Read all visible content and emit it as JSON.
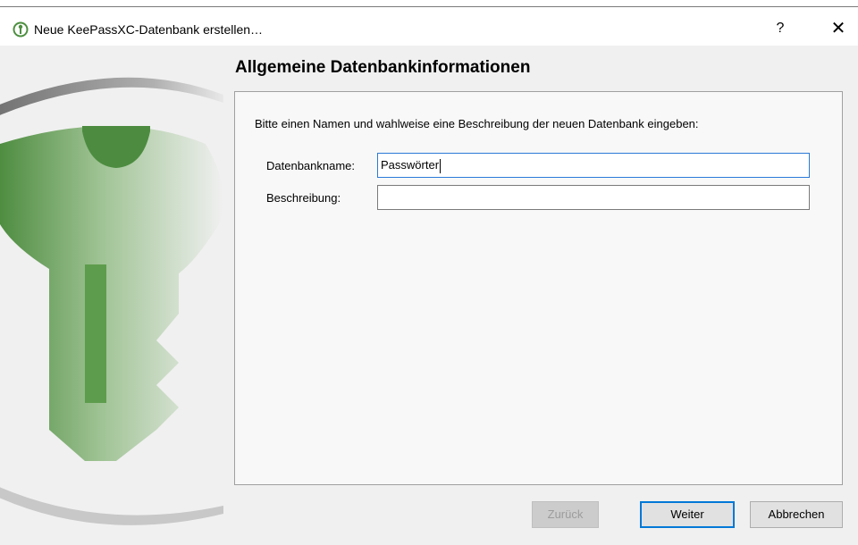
{
  "window": {
    "title": "Neue KeePassXC-Datenbank erstellen…",
    "help_label": "?",
    "close_label": "✕"
  },
  "page": {
    "heading": "Allgemeine Datenbankinformationen",
    "instruction": "Bitte einen Namen und wahlweise eine Beschreibung der neuen Datenbank eingeben:"
  },
  "form": {
    "name_label": "Datenbankname:",
    "name_value": "Passwörter",
    "description_label": "Beschreibung:",
    "description_value": ""
  },
  "buttons": {
    "back": "Zurück",
    "next": "Weiter",
    "cancel": "Abbrechen"
  },
  "colors": {
    "brand_green": "#5e9c4d",
    "focus_blue": "#0078d7",
    "background": "#f0f0f0"
  }
}
